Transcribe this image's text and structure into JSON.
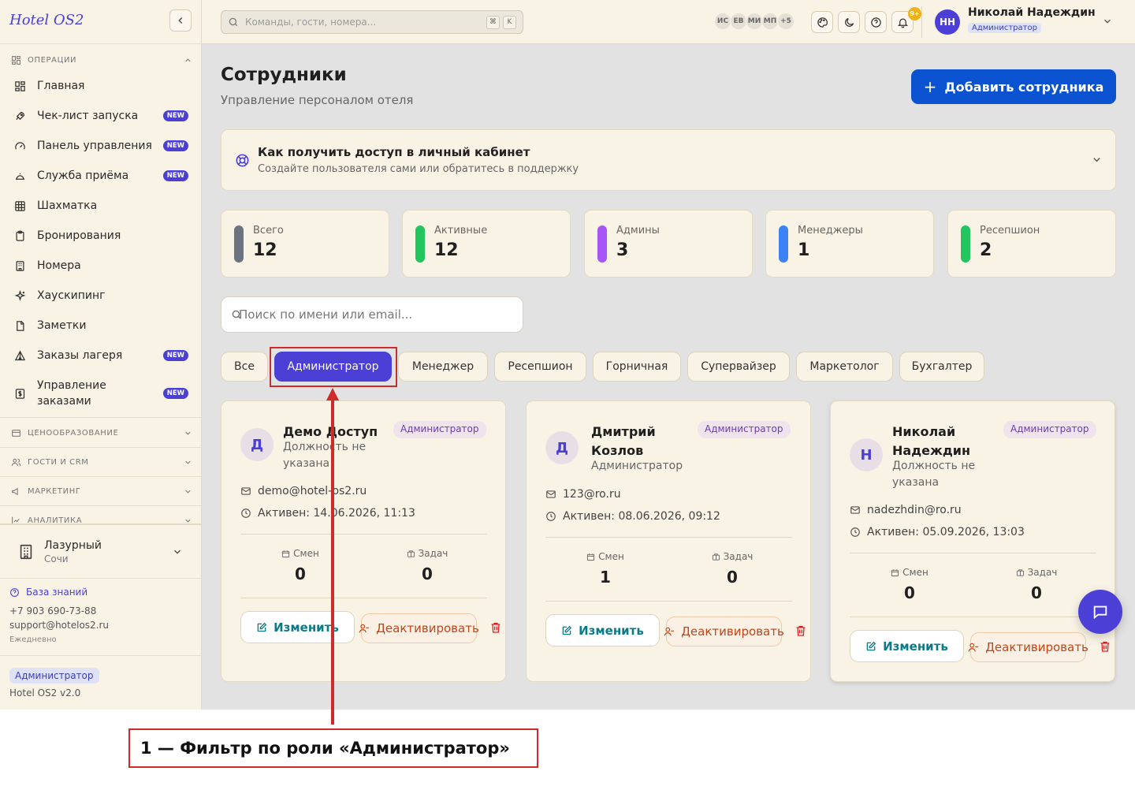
{
  "app": {
    "brand": "Hotel OS2"
  },
  "sidebar": {
    "sections": {
      "operations": "ОПЕРАЦИИ",
      "pricing": "ЦЕНООБРАЗОВАНИЕ",
      "guests": "ГОСТИ И CRM",
      "marketing": "МАРКЕТИНГ",
      "analytics": "АНАЛИТИКА"
    },
    "items": [
      {
        "label": "Главная",
        "badge": "",
        "icon": "dashboard-icon"
      },
      {
        "label": "Чек-лист запуска",
        "badge": "NEW",
        "icon": "rocket-icon"
      },
      {
        "label": "Панель управления",
        "badge": "NEW",
        "icon": "gauge-icon"
      },
      {
        "label": "Служба приёма",
        "badge": "NEW",
        "icon": "bell-icon"
      },
      {
        "label": "Шахматка",
        "badge": "",
        "icon": "grid-icon"
      },
      {
        "label": "Бронирования",
        "badge": "",
        "icon": "clipboard-icon"
      },
      {
        "label": "Номера",
        "badge": "",
        "icon": "building-icon"
      },
      {
        "label": "Хаускипинг",
        "badge": "",
        "icon": "sparkles-icon"
      },
      {
        "label": "Заметки",
        "badge": "",
        "icon": "note-icon"
      },
      {
        "label": "Заказы лагеря",
        "badge": "NEW",
        "icon": "tent-icon"
      },
      {
        "label": "Управление заказами",
        "badge": "NEW",
        "icon": "dollar-icon"
      }
    ],
    "hotel": {
      "name": "Лазурный",
      "city": "Сочи"
    },
    "knowledge_base": "База знаний",
    "phone": "+7 903 690-73-88",
    "email": "support@hotelos2.ru",
    "schedule": "Ежедневно",
    "role": "Администратор",
    "version": "Hotel OS2 v2.0"
  },
  "topbar": {
    "search_placeholder": "Команды, гости, номера...",
    "kbd": [
      "⌘",
      "K"
    ],
    "online_users": [
      "ИС",
      "ЕВ",
      "МИ",
      "МП",
      "+5"
    ],
    "notif_count": "9+",
    "user": {
      "initials": "НН",
      "name": "Николай Надеждин",
      "role": "Администратор"
    }
  },
  "page": {
    "title": "Сотрудники",
    "subtitle": "Управление персоналом отеля",
    "add_button": "Добавить сотрудника",
    "info": {
      "title": "Как получить доступ в личный кабинет",
      "subtitle": "Создайте пользователя сами или обратитесь в поддержку"
    },
    "stats": [
      {
        "label": "Всего",
        "value": "12",
        "color": "#6b7280"
      },
      {
        "label": "Активные",
        "value": "12",
        "color": "#22c55e"
      },
      {
        "label": "Админы",
        "value": "3",
        "color": "#a855f7"
      },
      {
        "label": "Менеджеры",
        "value": "1",
        "color": "#3b82f6"
      },
      {
        "label": "Ресепшион",
        "value": "2",
        "color": "#22c55e"
      }
    ],
    "search_placeholder": "Поиск по имени или email...",
    "filters": [
      "Все",
      "Администратор",
      "Менеджер",
      "Ресепшион",
      "Горничная",
      "Супервайзер",
      "Маркетолог",
      "Бухгалтер"
    ],
    "active_filter": "Администратор",
    "employees": [
      {
        "initial": "Д",
        "name": "Демо Доступ",
        "position": "Должность не указана",
        "role": "Администратор",
        "email": "demo@hotel-os2.ru",
        "active": "Активен: 14.06.2026, 11:13",
        "shifts_label": "Смен",
        "shifts": "0",
        "tasks_label": "Задач",
        "tasks": "0",
        "edit": "Изменить",
        "deactivate": "Деактивировать"
      },
      {
        "initial": "Д",
        "name": "Дмитрий Козлов",
        "position": "Администратор",
        "role": "Администратор",
        "email": "123@ro.ru",
        "active": "Активен: 08.06.2026, 09:12",
        "shifts_label": "Смен",
        "shifts": "1",
        "tasks_label": "Задач",
        "tasks": "0",
        "edit": "Изменить",
        "deactivate": "Деактивировать"
      },
      {
        "initial": "Н",
        "name": "Николай Надеждин",
        "position": "Должность не указана",
        "role": "Администратор",
        "email": "nadezhdin@ro.ru",
        "active": "Активен: 05.09.2026, 13:03",
        "shifts_label": "Смен",
        "shifts": "0",
        "tasks_label": "Задач",
        "tasks": "0",
        "edit": "Изменить",
        "deactivate": "Деактивировать"
      }
    ]
  },
  "annotation": {
    "caption": "1 — Фильтр по роли «Администратор»",
    "color": "#d12a2a"
  }
}
